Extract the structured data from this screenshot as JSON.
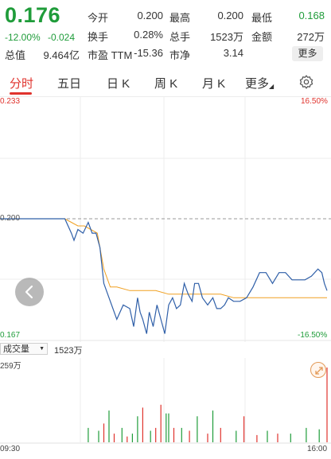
{
  "quote": {
    "price": "0.176",
    "change_pct": "-12.00%",
    "change_abs": "-0.024",
    "fields": [
      {
        "label": "今开",
        "value": "0.200",
        "tone": "normal"
      },
      {
        "label": "最高",
        "value": "0.200",
        "tone": "normal"
      },
      {
        "label": "最低",
        "value": "0.168",
        "tone": "green"
      },
      {
        "label": "换手",
        "value": "0.28%",
        "tone": "normal"
      },
      {
        "label": "总手",
        "value": "1523万",
        "tone": "normal"
      },
      {
        "label": "金额",
        "value": "272万",
        "tone": "normal"
      },
      {
        "label": "总值",
        "value": "9.464亿",
        "tone": "normal"
      },
      {
        "label": "市盈 TTM",
        "value": "-15.36",
        "tone": "normal"
      },
      {
        "label": "市净",
        "value": "3.14",
        "tone": "normal"
      }
    ],
    "more_label": "更多"
  },
  "tabs": [
    {
      "label": "分时",
      "active": true
    },
    {
      "label": "五日",
      "active": false
    },
    {
      "label": "日 K",
      "active": false
    },
    {
      "label": "周 K",
      "active": false
    },
    {
      "label": "月 K",
      "active": false
    },
    {
      "label": "更多",
      "active": false
    }
  ],
  "chart": {
    "y_top": "0.233",
    "y_mid": "0.200",
    "y_bottom": "0.167",
    "pct_top": "16.50%",
    "pct_bottom": "-16.50%",
    "volume_selector": "成交量",
    "volume_total": "1523万",
    "volume_axis_max": "259万",
    "time_start": "09:30",
    "time_end": "16:00"
  },
  "colors": {
    "up": "#e0332d",
    "down": "#1f9c3a",
    "price_line": "#2f5fa8",
    "avg_line": "#f0a020"
  },
  "chart_data": {
    "type": "line",
    "prev_close": 0.2,
    "ylim": [
      0.167,
      0.233
    ],
    "series": [
      {
        "name": "price",
        "x": [
          0,
          30,
          50,
          55,
          57,
          60,
          64,
          68,
          71,
          74,
          77,
          80,
          84,
          90,
          95,
          100,
          103,
          106,
          108,
          110,
          113,
          115,
          118,
          121,
          124,
          127,
          130,
          133,
          136,
          139,
          142,
          145,
          148,
          150,
          153,
          156,
          160,
          164,
          167,
          170,
          173,
          176,
          180,
          185,
          190,
          195,
          200,
          205,
          210,
          215,
          220,
          225,
          230,
          235,
          240,
          245,
          248,
          250,
          252
        ],
        "values": [
          0.2,
          0.2,
          0.2,
          0.196,
          0.194,
          0.197,
          0.196,
          0.199,
          0.196,
          0.196,
          0.192,
          0.182,
          0.178,
          0.172,
          0.176,
          0.175,
          0.17,
          0.178,
          0.174,
          0.172,
          0.168,
          0.174,
          0.17,
          0.176,
          0.172,
          0.168,
          0.176,
          0.178,
          0.175,
          0.176,
          0.182,
          0.179,
          0.177,
          0.182,
          0.182,
          0.178,
          0.176,
          0.178,
          0.175,
          0.175,
          0.176,
          0.178,
          0.177,
          0.177,
          0.178,
          0.181,
          0.185,
          0.185,
          0.182,
          0.185,
          0.185,
          0.183,
          0.183,
          0.183,
          0.184,
          0.186,
          0.185,
          0.182,
          0.18
        ]
      },
      {
        "name": "avg",
        "x": [
          0,
          30,
          50,
          55,
          60,
          65,
          70,
          75,
          80,
          85,
          90,
          100,
          110,
          120,
          130,
          140,
          150,
          160,
          170,
          180,
          190,
          200,
          210,
          220,
          230,
          240,
          250,
          252
        ],
        "values": [
          0.2,
          0.2,
          0.2,
          0.199,
          0.198,
          0.198,
          0.197,
          0.196,
          0.186,
          0.181,
          0.181,
          0.18,
          0.18,
          0.18,
          0.179,
          0.179,
          0.179,
          0.179,
          0.179,
          0.178,
          0.178,
          0.178,
          0.178,
          0.178,
          0.178,
          0.178,
          0.178,
          0.178
        ]
      }
    ],
    "volume": {
      "ymax": 2590000,
      "x": [
        68,
        76,
        80,
        84,
        88,
        94,
        98,
        102,
        106,
        110,
        116,
        120,
        124,
        128,
        130,
        134,
        140,
        146,
        152,
        160,
        164,
        170,
        182,
        188,
        198,
        206,
        214,
        224,
        236,
        246,
        252
      ],
      "values": [
        500000,
        400000,
        650000,
        1100000,
        300000,
        500000,
        200000,
        300000,
        900000,
        1200000,
        400000,
        500000,
        1300000,
        1000000,
        1000000,
        500000,
        500000,
        400000,
        900000,
        300000,
        1100000,
        500000,
        400000,
        900000,
        250000,
        400000,
        300000,
        300000,
        500000,
        450000,
        2590000
      ],
      "up": [
        false,
        false,
        true,
        false,
        true,
        false,
        true,
        false,
        false,
        true,
        false,
        true,
        true,
        false,
        false,
        true,
        false,
        true,
        false,
        true,
        false,
        true,
        false,
        true,
        true,
        false,
        true,
        false,
        false,
        false,
        true
      ]
    }
  }
}
